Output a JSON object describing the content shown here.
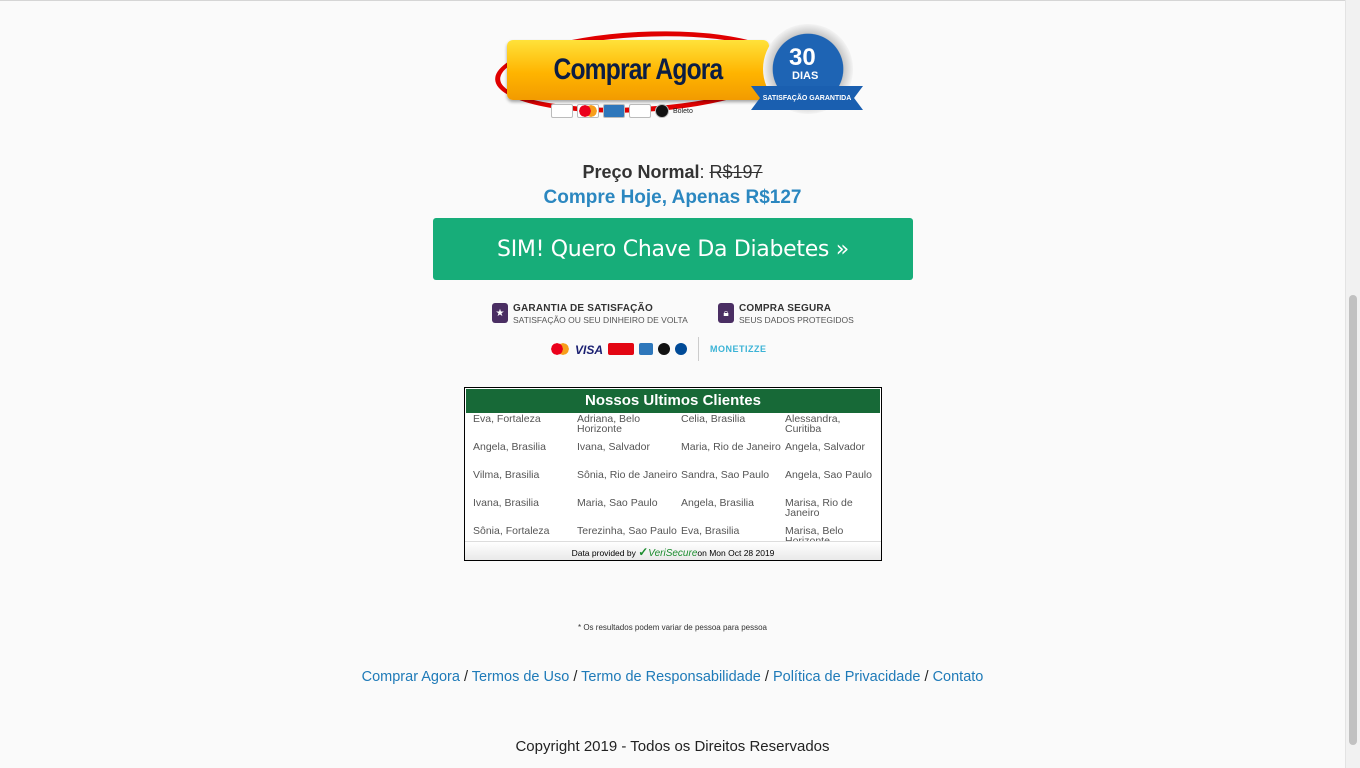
{
  "banner": {
    "buy_label": "Comprar Agora",
    "boleto_label": "Boleto",
    "seal_number": "30",
    "seal_unit": "DIAS",
    "seal_ribbon": "SATISFAÇÃO GARANTIDA"
  },
  "pricing": {
    "normal_label": "Preço Normal",
    "normal_sep": ": ",
    "normal_price": "R$197",
    "today": "Compre Hoje, Apenas R$127"
  },
  "cta": {
    "label": "SIM! Quero Chave Da Diabetes »"
  },
  "guarantee": {
    "satisfaction_title": "GARANTIA DE SATISFAÇÃO",
    "satisfaction_sub": "SATISFAÇÃO OU SEU DINHEIRO DE VOLTA",
    "secure_title": "COMPRA SEGURA",
    "secure_sub": "SEUS DADOS PROTEGIDOS",
    "visa": "VISA",
    "monetizze": "MONETIZZE"
  },
  "clients": {
    "title": "Nossos Ultimos Clientes",
    "names": [
      "Eva, Fortaleza",
      "Adriana, Belo Horizonte",
      "Celia, Brasilia",
      "Alessandra, Curitiba",
      "Angela, Brasilia",
      "Ivana, Salvador",
      "Maria, Rio de Janeiro",
      "Angela, Salvador",
      "Vilma, Brasilia",
      "Sônia, Rio de Janeiro",
      "Sandra, Sao Paulo",
      "Angela, Sao Paulo",
      "Ivana, Brasilia",
      "Maria, Sao Paulo",
      "Angela, Brasilia",
      "Marisa, Rio de Janeiro",
      "Sônia, Fortaleza",
      "Terezinha, Sao Paulo",
      "Eva, Brasilia",
      "Marisa, Belo Horizonte"
    ],
    "footer_prefix": "Data provided by",
    "footer_brand_a": "Veri",
    "footer_brand_b": "Secure",
    "footer_suffix": "on Mon Oct 28 2019"
  },
  "disclaimer": "* Os resultados podem variar de pessoa para pessoa",
  "footer": {
    "links": [
      "Comprar Agora",
      "Termos de Uso",
      "Termo de Responsabilidade",
      "Política de Privacidade",
      "Contato"
    ],
    "separator": " / ",
    "copyright": "Copyright 2019 - Todos os Direitos Reservados"
  },
  "colors": {
    "cta": "#17ad79",
    "price_today": "#2b87c0",
    "clients_header": "#176937",
    "link": "#1e7ab8"
  }
}
